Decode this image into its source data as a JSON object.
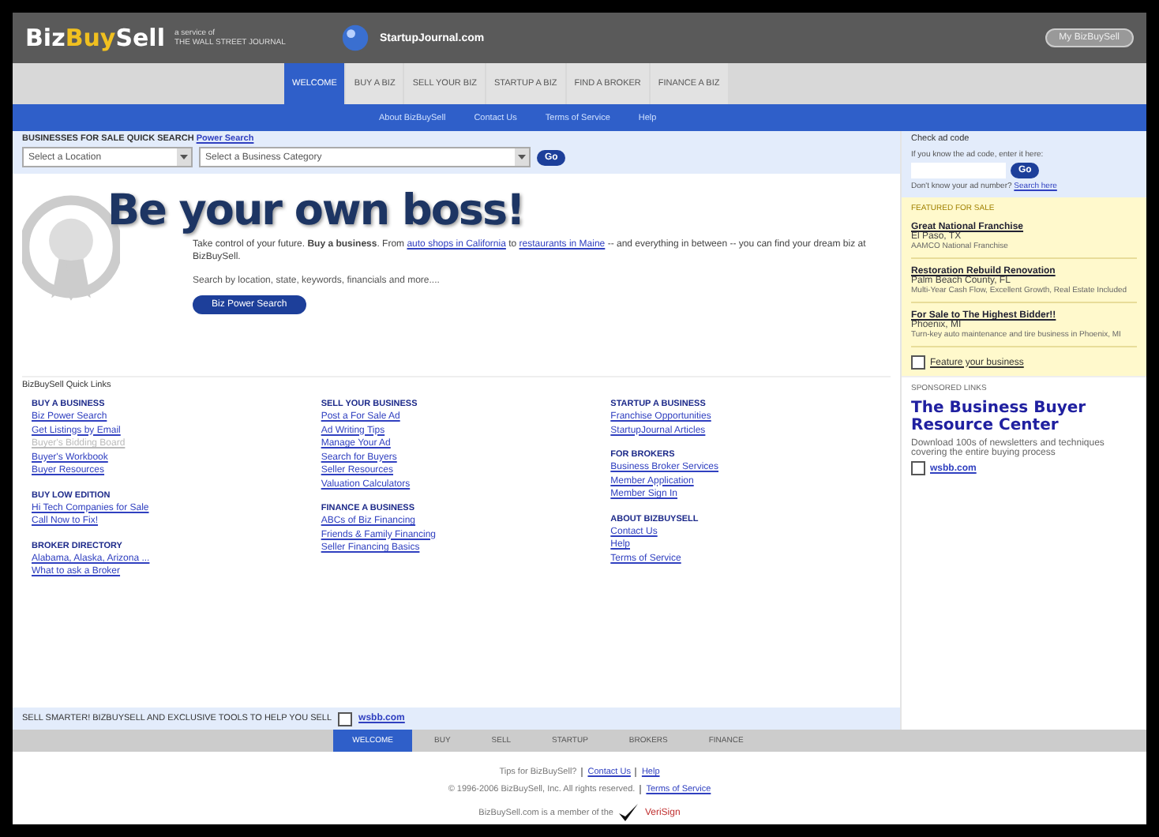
{
  "header": {
    "logo_a": "Biz",
    "logo_b": "Buy",
    "logo_c": "Sell",
    "tagline": "a service of\nTHE WALL STREET JOURNAL",
    "partner": "StartupJournal.com",
    "account_button": "My BizBuySell"
  },
  "tabs": [
    {
      "label": "WELCOME",
      "selected": true
    },
    {
      "label": "BUY A BIZ",
      "selected": false
    },
    {
      "label": "SELL YOUR BIZ",
      "selected": false
    },
    {
      "label": "STARTUP A BIZ",
      "selected": false
    },
    {
      "label": "FIND A BROKER",
      "selected": false
    },
    {
      "label": "FINANCE A BIZ",
      "selected": false
    }
  ],
  "subnav": [
    "About BizBuySell",
    "Contact Us",
    "Terms of Service",
    "Help"
  ],
  "quick_search": {
    "title": "BUSINESSES FOR SALE QUICK SEARCH",
    "link": "Power Search",
    "location": "Select a Location",
    "category": "Select a Business Category",
    "go": "Go"
  },
  "hero": {
    "title": "Be your own boss!",
    "text": "Take control of your future. **Buy a business**. From ",
    "link_1": "auto shops in California",
    "mid": " to ",
    "link_2": "restaurants in Maine",
    "rest": " -- and everything in between -- you can find your dream biz at BizBuySell.",
    "search_text": "Search by location, state, keywords, financials and more....",
    "button": "Biz Power Search"
  },
  "quick_links": {
    "title": "BizBuySell Quick Links",
    "columns": [
      [
        {
          "heading": "BUY A BUSINESS",
          "links": [
            {
              "label": "Biz Power Search",
              "disabled": false
            },
            {
              "label": "Get Listings by Email",
              "disabled": false
            },
            {
              "label": "Buyer's Bidding Board",
              "disabled": true
            },
            {
              "label": "Buyer's Workbook",
              "disabled": false
            },
            {
              "label": "Buyer Resources",
              "disabled": false
            }
          ]
        },
        {
          "heading": "BUY LOW EDITION",
          "links": [
            {
              "label": "Hi Tech Companies for Sale",
              "disabled": false
            },
            {
              "label": "Call Now to Fix!",
              "disabled": false
            }
          ]
        },
        {
          "heading": "BROKER DIRECTORY",
          "links": [
            {
              "label": "Alabama, Alaska, Arizona ...",
              "disabled": false
            },
            {
              "label": "What to ask a Broker",
              "disabled": false
            }
          ]
        }
      ],
      [
        {
          "heading": "SELL YOUR BUSINESS",
          "links": [
            {
              "label": "Post a For Sale Ad",
              "disabled": false
            },
            {
              "label": "Ad Writing Tips",
              "disabled": false
            },
            {
              "label": "Manage Your Ad",
              "disabled": false
            },
            {
              "label": "Search for Buyers",
              "disabled": false
            },
            {
              "label": "Seller Resources",
              "disabled": false
            },
            {
              "label": "Valuation Calculators",
              "disabled": false
            }
          ]
        },
        {
          "heading": "FINANCE A BUSINESS",
          "links": [
            {
              "label": "ABCs of Biz Financing",
              "disabled": false
            },
            {
              "label": "Friends & Family Financing",
              "disabled": false
            },
            {
              "label": "Seller Financing Basics",
              "disabled": false
            }
          ]
        }
      ],
      [
        {
          "heading": "STARTUP A BUSINESS",
          "links": [
            {
              "label": "Franchise Opportunities",
              "disabled": false
            },
            {
              "label": "StartupJournal Articles",
              "disabled": false
            }
          ]
        },
        {
          "heading": "FOR BROKERS",
          "links": [
            {
              "label": "Business Broker Services",
              "disabled": false
            },
            {
              "label": "Member Application",
              "disabled": false
            },
            {
              "label": "Member Sign In",
              "disabled": false
            }
          ]
        },
        {
          "heading": "ABOUT BIZBUYSELL",
          "links": [
            {
              "label": "Contact Us",
              "disabled": false
            },
            {
              "label": "Help",
              "disabled": false
            },
            {
              "label": "Terms of Service",
              "disabled": false
            }
          ]
        }
      ]
    ]
  },
  "promo_bar": {
    "text": "SELL SMARTER! BIZBUYSELL AND EXCLUSIVE TOOLS TO HELP YOU SELL",
    "link": "wsbb.com"
  },
  "sidebar": {
    "ad_code": {
      "title": "Check ad code",
      "hint": "If you know the ad code, enter it here:",
      "go": "Go",
      "search_text": "Don't know your ad number?",
      "search_link": "Search here"
    },
    "featured": {
      "title": "FEATURED FOR SALE",
      "listings": [
        {
          "name": "Great National Franchise",
          "place": "El Paso, TX",
          "desc": "AAMCO National Franchise"
        },
        {
          "name": "Restoration Rebuild Renovation",
          "place": "Palm Beach County, FL",
          "desc": "Multi-Year Cash Flow, Excellent Growth, Real Estate Included"
        },
        {
          "name": "For Sale to The Highest Bidder!!",
          "place": "Phoenix, MI",
          "desc": "Turn-key auto maintenance and tire business in Phoenix, MI"
        }
      ],
      "feature_link": "Feature your business"
    },
    "sponsored": {
      "title": "SPONSORED LINKS",
      "headline": "The Business Buyer Resource Center",
      "text": "Download 100s of newsletters and techniques covering the entire buying process",
      "link": "wsbb.com"
    }
  },
  "footer": {
    "tabs": [
      {
        "label": "WELCOME",
        "selected": true
      },
      {
        "label": "BUY",
        "selected": false
      },
      {
        "label": "SELL",
        "selected": false
      },
      {
        "label": "STARTUP",
        "selected": false
      },
      {
        "label": "BROKERS",
        "selected": false
      },
      {
        "label": "FINANCE",
        "selected": false
      }
    ],
    "line_1": "Tips for BizBuySell?",
    "link_1": "Contact Us",
    "link_2": "Help",
    "line_2": "© 1996-2006 BizBuySell, Inc. All rights reserved.",
    "link_3": "Terms of Service",
    "line_3": "BizBuySell.com is a member of the",
    "badge": "VeriSign"
  }
}
